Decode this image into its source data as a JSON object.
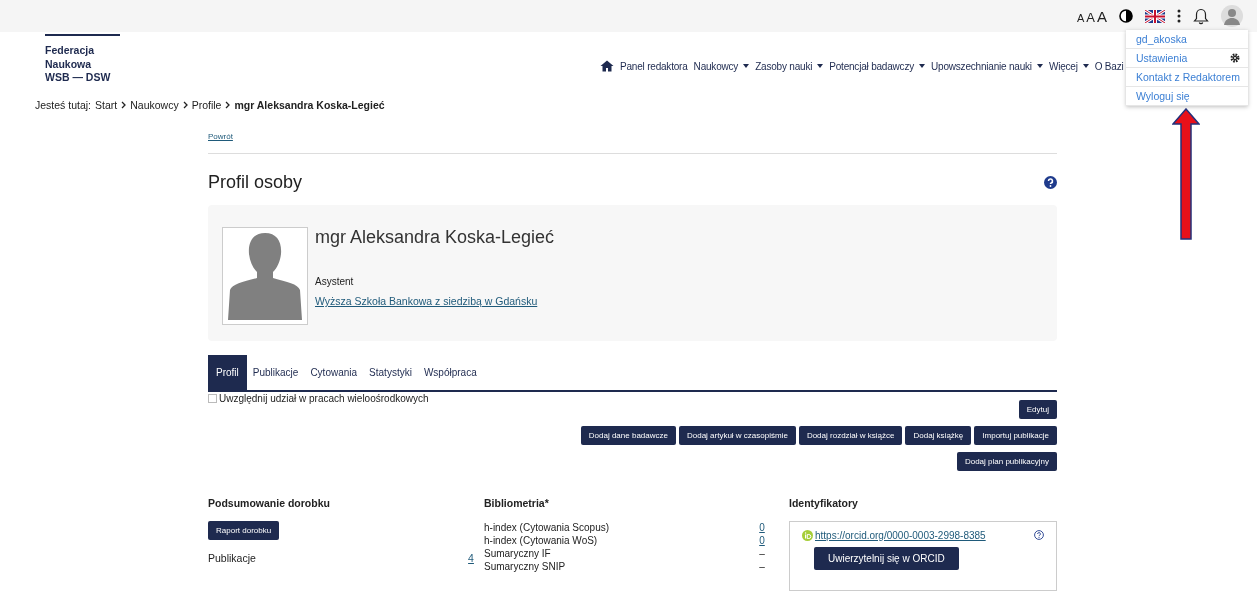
{
  "top_bar": {
    "font_sizes": [
      "A",
      "A",
      "A"
    ]
  },
  "user_menu": {
    "items": [
      {
        "label": "gd_akoska",
        "gear": false
      },
      {
        "label": "Ustawienia",
        "gear": true
      },
      {
        "label": "Kontakt z Redaktorem",
        "gear": false
      },
      {
        "label": "Wyloguj się",
        "gear": false
      }
    ]
  },
  "logo": {
    "lines": [
      "Federacja",
      "Naukowa",
      "WSB — DSW"
    ]
  },
  "nav": {
    "items": [
      {
        "label": "Panel redaktora",
        "dropdown": false
      },
      {
        "label": "Naukowcy",
        "dropdown": true
      },
      {
        "label": "Zasoby nauki",
        "dropdown": true
      },
      {
        "label": "Potencjał badawczy",
        "dropdown": true
      },
      {
        "label": "Upowszechnianie nauki",
        "dropdown": true
      },
      {
        "label": "Więcej",
        "dropdown": true
      },
      {
        "label": "O Bazi",
        "dropdown": false
      }
    ]
  },
  "breadcrumb": {
    "prefix": "Jesteś tutaj:",
    "items": [
      "Start",
      "Naukowcy",
      "Profile"
    ],
    "current": "mgr Aleksandra Koska-Legieć"
  },
  "back_link": "Powrót",
  "page_title": "Profil osoby",
  "profile": {
    "name": "mgr Aleksandra Koska-Legieć",
    "position": "Asystent",
    "affiliation": "Wyższa Szkoła Bankowa z siedzibą w Gdańsku"
  },
  "tabs": [
    {
      "label": "Profil",
      "selected": true
    },
    {
      "label": "Publikacje",
      "selected": false
    },
    {
      "label": "Cytowania",
      "selected": false
    },
    {
      "label": "Statystyki",
      "selected": false
    },
    {
      "label": "Współpraca",
      "selected": false
    }
  ],
  "multicenter_checkbox": {
    "label": "Uwzględnij udział w pracach wieloośrodkowych",
    "checked": false
  },
  "edit_button": "Edytuj",
  "action_rows": [
    [
      "Dodaj dane badawcze",
      "Dodaj artykuł w czasopiśmie",
      "Dodaj rozdział w książce",
      "Dodaj książkę",
      "Importuj publikacje"
    ],
    [
      "Dodaj plan publikacyjny"
    ]
  ],
  "summary": {
    "title": "Podsumowanie dorobku",
    "button": "Raport dorobku",
    "rows": [
      {
        "label": "Publikacje",
        "value": "4",
        "link": true
      }
    ]
  },
  "bibliometrics": {
    "title": "Bibliometria*",
    "rows": [
      {
        "label": "h-index (Cytowania Scopus)",
        "value": "0",
        "link": true
      },
      {
        "label": "h-index (Cytowania WoS)",
        "value": "0",
        "link": true
      },
      {
        "label": "Sumaryczny IF",
        "value": "–",
        "link": false
      },
      {
        "label": "Sumaryczny SNIP",
        "value": "–",
        "link": false
      }
    ]
  },
  "identifiers": {
    "title": "Identyfikatory",
    "orcid_url": "https://orcid.org/0000-0003-2998-8385",
    "button": "Uwierzytelnij się w ORCID"
  }
}
